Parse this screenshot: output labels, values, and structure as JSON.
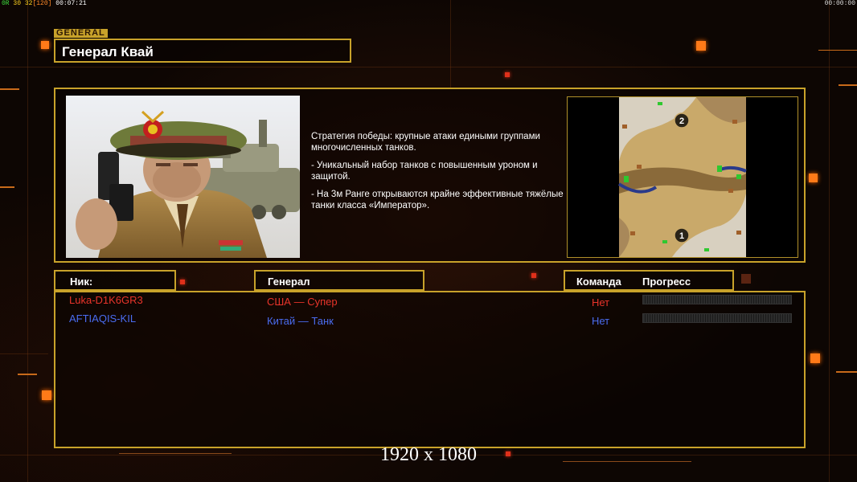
{
  "topbar": {
    "counter_a": "0R",
    "counter_b": "30",
    "counter_c": "32",
    "counter_d": "[120]",
    "time_left": "00:07:21",
    "time_right": "00:00:00"
  },
  "general": {
    "section_tag": "GENERAL",
    "name": "Генерал Квай"
  },
  "description": {
    "line1": "Стратегия победы: крупные атаки едиными группами многочисленных танков.",
    "line2": "- Уникальный набор танков с повышенным уроном и защитой.",
    "line3": "- На 3м Ранге открываются крайне эффективные тяжёлые танки класса «Император»."
  },
  "map": {
    "marker_top": "2",
    "marker_bottom": "1"
  },
  "columns": {
    "nick": "Ник:",
    "general": "Генерал",
    "team": "Команда",
    "progress": "Прогресс"
  },
  "players": [
    {
      "nick": "Luka-D1K6GR3",
      "general": "США — Супер",
      "team": "Нет",
      "progress": 0,
      "color": "#e8342a"
    },
    {
      "nick": "AFTIAQIS-KIL",
      "general": "Китай — Танк",
      "team": "Нет",
      "progress": 0,
      "color": "#4a6cf0"
    }
  ],
  "resolution_label": "1920 x 1080",
  "colors": {
    "frame": "#c8a22a",
    "accent": "#ff7a18",
    "background": "#0d0603"
  }
}
